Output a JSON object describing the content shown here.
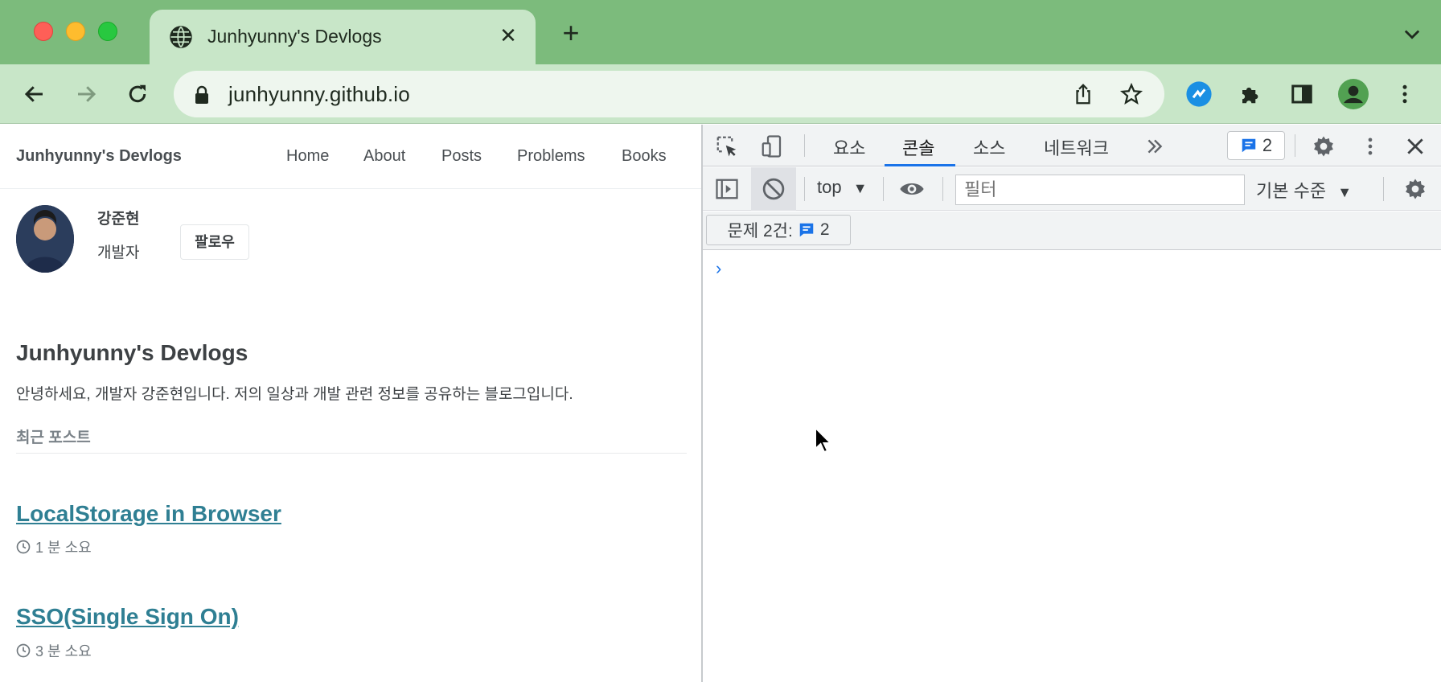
{
  "browser": {
    "tab": {
      "title": "Junhyunny's Devlogs"
    },
    "address": {
      "url": "junhyunny.github.io"
    }
  },
  "page": {
    "site_title": "Junhyunny's Devlogs",
    "nav": [
      "Home",
      "About",
      "Posts",
      "Problems",
      "Books"
    ],
    "author": {
      "name": "강준현",
      "bio": "개발자",
      "follow_label": "팔로우"
    },
    "blog_title": "Junhyunny's Devlogs",
    "blog_description": "안녕하세요, 개발자 강준현입니다. 저의 일상과 개발 관련 정보를 공유하는 블로그입니다.",
    "recent_posts_label": "최근 포스트",
    "posts": [
      {
        "title": "LocalStorage in Browser",
        "read_time": "1 분 소요"
      },
      {
        "title": "SSO(Single Sign On)",
        "read_time": "3 분 소요"
      }
    ]
  },
  "devtools": {
    "tabs": [
      "요소",
      "콘솔",
      "소스",
      "네트워크"
    ],
    "active_tab": "콘솔",
    "issue_count": "2",
    "context": "top",
    "filter_placeholder": "필터",
    "level": "기본 수준",
    "issues_label": "문제 2건:",
    "issues_count": "2",
    "prompt": "›"
  },
  "colors": {
    "frame": "#7cbb7c",
    "toolbar": "#c8e6c8",
    "link": "#2f7f93",
    "devtools_accent": "#1a73e8"
  }
}
